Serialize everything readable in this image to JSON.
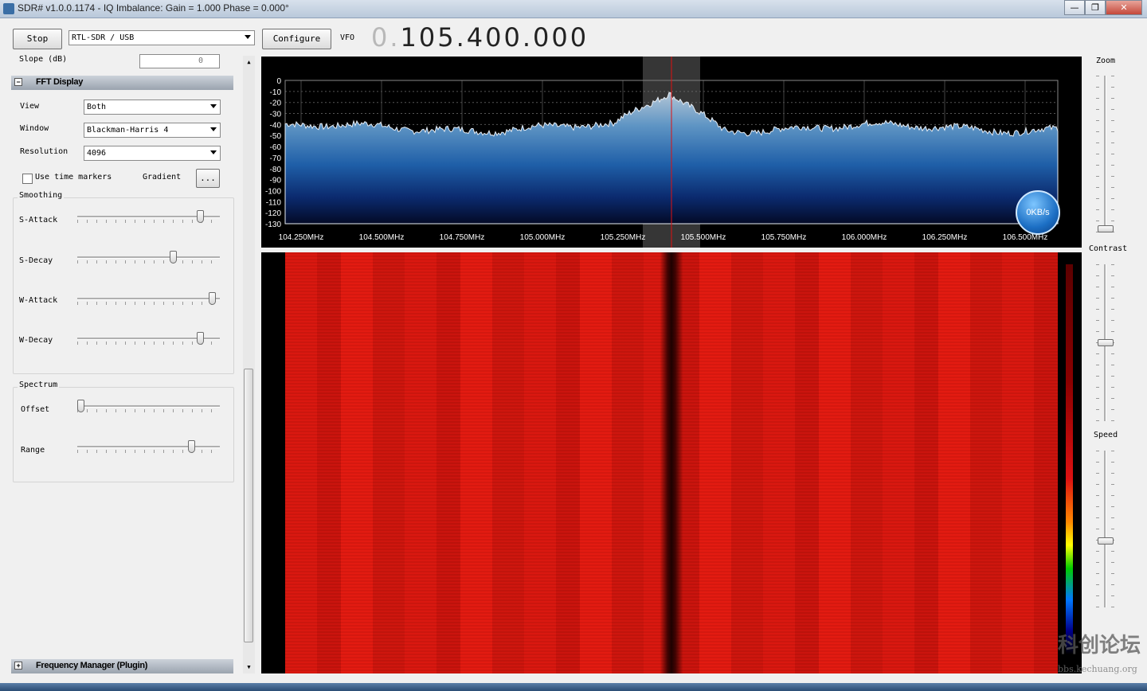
{
  "window": {
    "title": "SDR# v1.0.0.1174 - IQ Imbalance: Gain = 1.000 Phase = 0.000°",
    "min": "—",
    "max": "❐",
    "close": "✕"
  },
  "toolbar": {
    "stop_label": "Stop",
    "device": "RTL-SDR / USB",
    "configure_label": "Configure",
    "vfo_label": "VFO",
    "vfo_dim": "0.",
    "vfo_value": "105.400.000"
  },
  "left_panel": {
    "slope_label": "Slope (dB)",
    "slope_value": "0",
    "fft_header": "FFT Display",
    "view_label": "View",
    "view_value": "Both",
    "window_label": "Window",
    "window_value": "Blackman-Harris 4",
    "resolution_label": "Resolution",
    "resolution_value": "4096",
    "time_markers_label": "Use time markers",
    "gradient_label": "Gradient",
    "gradient_button": "...",
    "smoothing_title": "Smoothing",
    "s_attack_label": "S-Attack",
    "s_decay_label": "S-Decay",
    "w_attack_label": "W-Attack",
    "w_decay_label": "W-Decay",
    "spectrum_title": "Spectrum",
    "offset_label": "Offset",
    "range_label": "Range",
    "freq_manager_header": "Frequency Manager (Plugin)",
    "expand_icon": "+",
    "collapse_icon": "−",
    "sliders": {
      "s_attack": 0.88,
      "s_decay": 0.68,
      "w_attack": 0.97,
      "w_decay": 0.88,
      "offset": 0.0,
      "range": 0.82
    }
  },
  "right_panel": {
    "zoom_label": "Zoom",
    "contrast_label": "Contrast",
    "speed_label": "Speed",
    "zoom_level": 0.0,
    "contrast_level": 0.5,
    "speed_level": 0.42
  },
  "spectrum": {
    "db_ticks": [
      "0",
      "-10",
      "-20",
      "-30",
      "-40",
      "-50",
      "-60",
      "-70",
      "-80",
      "-90",
      "-100",
      "-110",
      "-120",
      "-130"
    ],
    "freq_ticks": [
      "104.250MHz",
      "104.500MHz",
      "104.750MHz",
      "105.000MHz",
      "105.250MHz",
      "105.500MHz",
      "105.750MHz",
      "106.000MHz",
      "106.250MHz",
      "106.500MHz"
    ],
    "rate_badge": "0KB/s"
  },
  "watermark": {
    "text": "科创论坛",
    "sub": "bbs.kechuang.org"
  }
}
